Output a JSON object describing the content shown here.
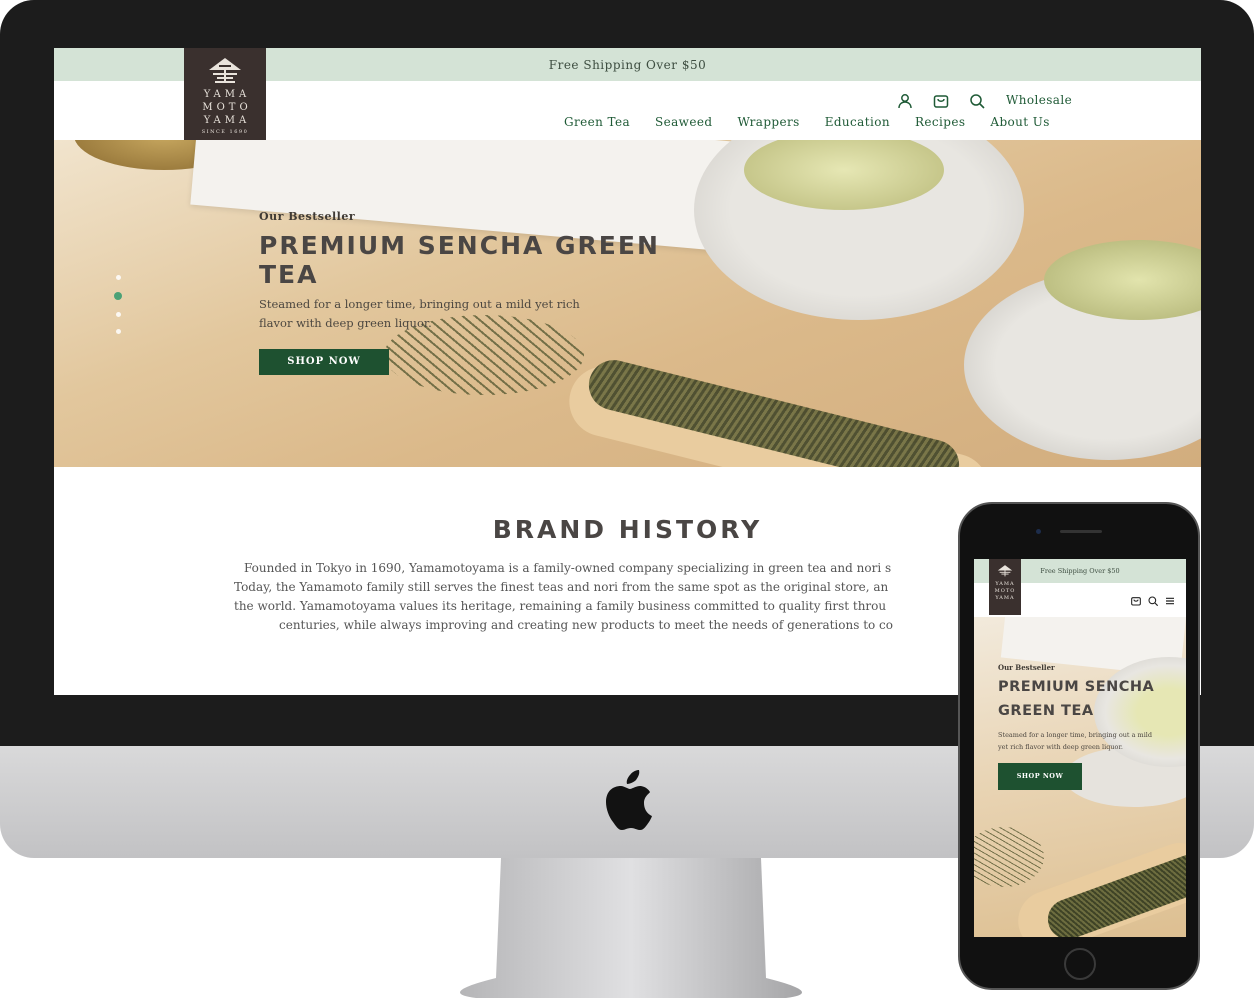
{
  "desktop": {
    "promo_text": "Free Shipping Over $50",
    "logo": {
      "lines": [
        "YAMA",
        "MOTO",
        "YAMA"
      ],
      "since": "SINCE 1690"
    },
    "utility_icons": [
      "account-icon",
      "cart-icon",
      "search-icon"
    ],
    "wholesale_label": "Wholesale",
    "nav": [
      "Green Tea",
      "Seaweed",
      "Wrappers",
      "Education",
      "Recipes",
      "About Us"
    ],
    "hero": {
      "kicker": "Our Bestseller",
      "title": "PREMIUM SENCHA GREEN TEA",
      "description": "Steamed for a longer time, bringing out a mild yet rich flavor with deep green liquor.",
      "cta": "SHOP NOW",
      "slide_count": 4,
      "active_slide": 2
    },
    "brand": {
      "title": "BRAND HISTORY",
      "lines": [
        "Founded in Tokyo in 1690, Yamamotoyama is a family-owned company specializing in green tea and nori s",
        "Today, the Yamamoto family still serves the finest teas and nori from the same spot as the original store, an",
        "the world. Yamamotoyama values its heritage, remaining a family business committed to quality first throu",
        "centuries, while always improving and creating new products to meet the needs of generations to co"
      ]
    }
  },
  "mobile": {
    "promo_text": "Free Shipping Over $50",
    "logo": {
      "lines": [
        "YAMA",
        "MOTO",
        "YAMA"
      ]
    },
    "icons": [
      "cart-icon",
      "search-icon",
      "menu-icon"
    ],
    "hero": {
      "kicker": "Our Bestseller",
      "title_line1": "PREMIUM SENCHA",
      "title_line2": "GREEN TEA",
      "description": "Steamed for a longer time, bringing out a mild yet rich flavor with deep green liquor.",
      "cta": "SHOP NOW"
    }
  },
  "colors": {
    "brand_green": "#1e5130",
    "nav_green": "#1f5a36",
    "promo_bg": "#d4e3d6",
    "logo_bg": "#3a302e",
    "active_dot": "#4ba176",
    "heading_gray": "#4a4644"
  }
}
